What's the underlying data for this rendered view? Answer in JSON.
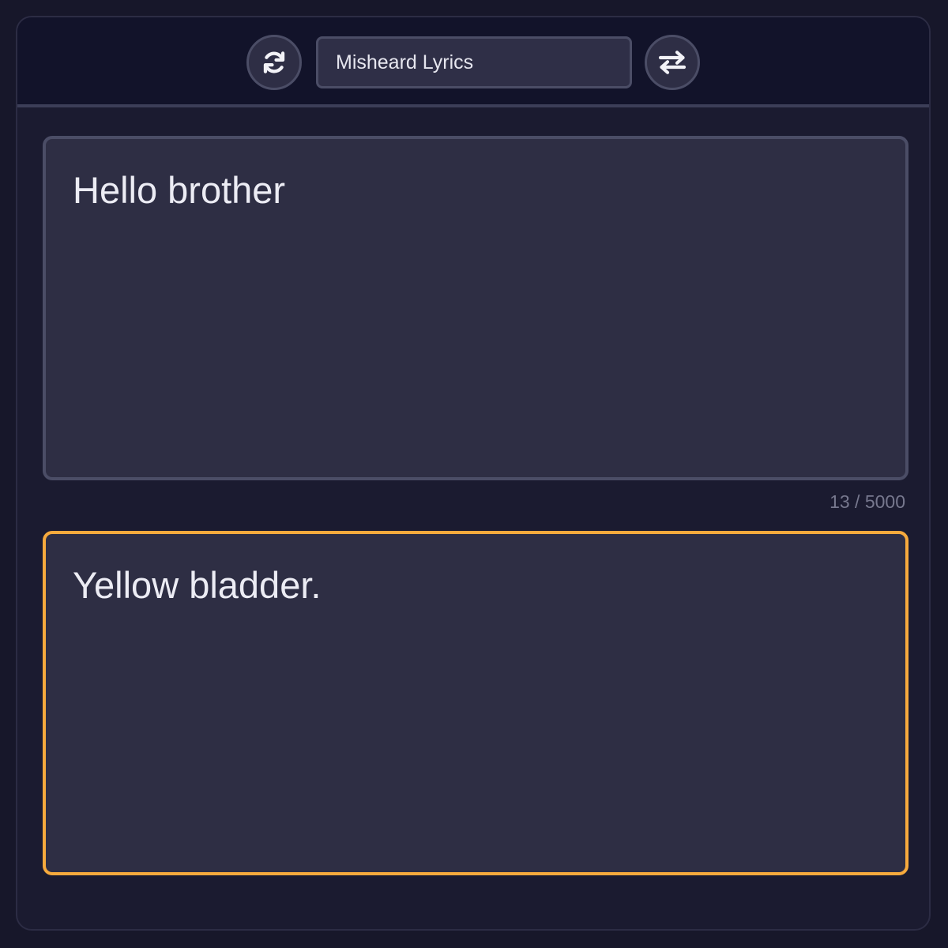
{
  "toolbar": {
    "refresh_icon": "refresh-icon",
    "swap_icon": "swap-icon",
    "mode": "Misheard Lyrics"
  },
  "input": {
    "text": "Hello brother"
  },
  "counter": {
    "text": "13 / 5000"
  },
  "output": {
    "text": "Yellow bladder."
  },
  "colors": {
    "accent": "#f7aa3d",
    "background": "#17172a",
    "panel": "#2e2e44",
    "border": "#4b4d66"
  }
}
